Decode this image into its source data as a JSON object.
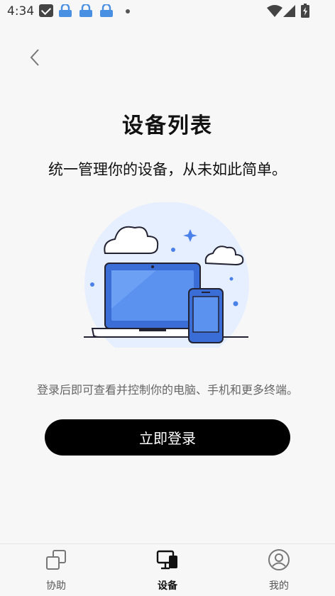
{
  "status_bar": {
    "time": "4:34",
    "icons": [
      "mail-icon",
      "lock-icon",
      "lock-icon",
      "lock-icon",
      "dot-icon",
      "wifi-icon",
      "signal-icon",
      "battery-icon"
    ]
  },
  "header": {
    "back_icon": "chevron-left-icon"
  },
  "main": {
    "title": "设备列表",
    "subtitle": "统一管理你的设备，从未如此简单。",
    "illustration": "laptop-phone-cloud-illustration",
    "description": "登录后即可查看并控制你的电脑、手机和更多终端。",
    "login_button": "立即登录"
  },
  "tabs": [
    {
      "label": "协助",
      "icon": "assist-icon",
      "active": false
    },
    {
      "label": "设备",
      "icon": "devices-icon",
      "active": true
    },
    {
      "label": "我的",
      "icon": "profile-icon",
      "active": false
    }
  ],
  "colors": {
    "accent": "#4a80e8",
    "illustration_bg": "#e6efff",
    "button_bg": "#000000"
  }
}
